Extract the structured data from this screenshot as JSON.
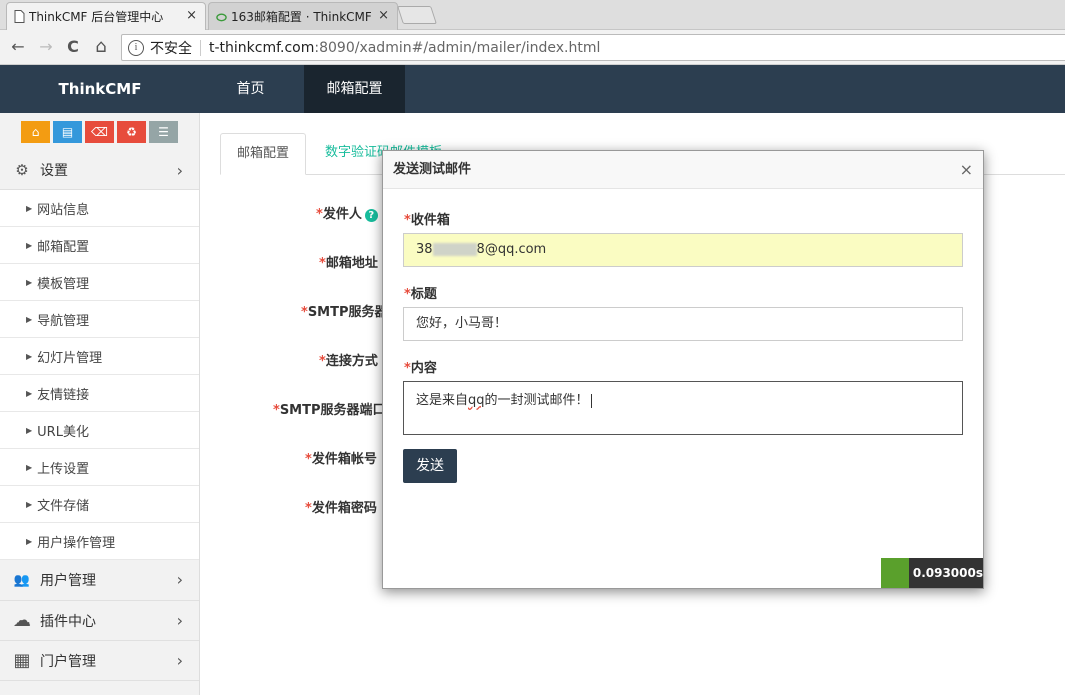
{
  "browser": {
    "tabs": [
      {
        "title": "ThinkCMF 后台管理中心",
        "close": "×"
      },
      {
        "title": "163邮箱配置 · ThinkCMF",
        "close": "×"
      }
    ],
    "nav": {
      "back": "←",
      "forward": "→",
      "reload": "C",
      "home": "⌂"
    },
    "address": {
      "security_label": "不安全",
      "host": "t-thinkcmf.com",
      "path": ":8090/xadmin#/admin/mailer/index.html"
    }
  },
  "topnav": {
    "brand": "ThinkCMF",
    "items": [
      {
        "label": "首页",
        "active": false
      },
      {
        "label": "邮箱配置",
        "active": true
      }
    ]
  },
  "shortcuts": [
    {
      "icon": "home-icon",
      "glyph": "⌂",
      "color": "#f39c12"
    },
    {
      "icon": "file-icon",
      "glyph": "▤",
      "color": "#3498db"
    },
    {
      "icon": "trash-icon",
      "glyph": "⌫",
      "color": "#e74c3c"
    },
    {
      "icon": "recycle-icon",
      "glyph": "♻",
      "color": "#e74c3c"
    },
    {
      "icon": "list-icon",
      "glyph": "☰",
      "color": "#95a5a6"
    }
  ],
  "sidebar": {
    "settings": {
      "label": "设置",
      "icon": "gears-icon",
      "glyph": "⚙",
      "arrow": "›"
    },
    "items": [
      {
        "label": "网站信息"
      },
      {
        "label": "邮箱配置"
      },
      {
        "label": "模板管理"
      },
      {
        "label": "导航管理"
      },
      {
        "label": "幻灯片管理"
      },
      {
        "label": "友情链接"
      },
      {
        "label": "URL美化"
      },
      {
        "label": "上传设置"
      },
      {
        "label": "文件存储"
      },
      {
        "label": "用户操作管理"
      }
    ],
    "groups": [
      {
        "label": "用户管理",
        "icon": "users-icon",
        "glyph": "👥",
        "arrow": "›"
      },
      {
        "label": "插件中心",
        "icon": "cloud-icon",
        "glyph": "☁",
        "arrow": "›"
      },
      {
        "label": "门户管理",
        "icon": "grid-icon",
        "glyph": "▦",
        "arrow": "›"
      }
    ]
  },
  "content": {
    "tabs": [
      {
        "label": "邮箱配置",
        "active": true
      },
      {
        "label": "数字验证码邮件模板",
        "active": false
      }
    ],
    "fields": [
      {
        "label": "发件人"
      },
      {
        "label": "邮箱地址"
      },
      {
        "label": "SMTP服务器"
      },
      {
        "label": "连接方式"
      },
      {
        "label": "SMTP服务器端口"
      },
      {
        "label": "发件箱帐号"
      },
      {
        "label": "发件箱密码"
      }
    ],
    "required_mark": "*",
    "help_mark": "?"
  },
  "modal": {
    "title": "发送测试邮件",
    "close": "×",
    "recipient": {
      "label": "收件箱",
      "value_prefix": "38",
      "value_suffix": "8@qq.com"
    },
    "subject": {
      "label": "标题",
      "value": "您好，小马哥！"
    },
    "body": {
      "label": "内容",
      "value_before": "这是来自",
      "value_misspelled": "qq",
      "value_after": "的一封测试邮件！"
    },
    "send_label": "发送",
    "timer": "0.093000s"
  }
}
